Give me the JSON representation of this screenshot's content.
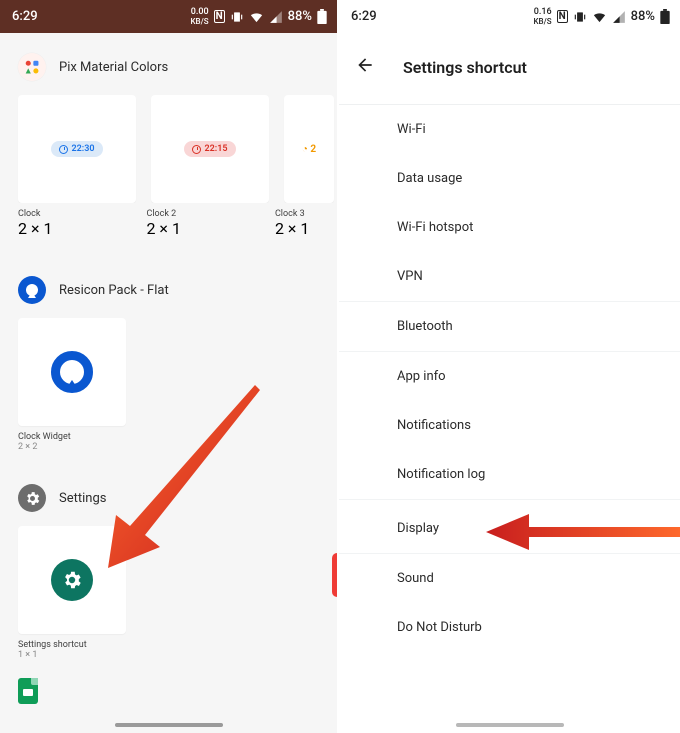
{
  "status_left": {
    "time": "6:29",
    "speed_val": "0.00",
    "speed_unit": "KB/S",
    "battery_pct": "88%"
  },
  "status_right": {
    "time": "6:29",
    "speed_val": "0.16",
    "speed_unit": "KB/S",
    "battery_pct": "88%"
  },
  "left": {
    "section1_title": "Pix Material Colors",
    "clock1": {
      "time": "22:30",
      "label": "Clock",
      "size": "2 × 1"
    },
    "clock2": {
      "time": "22:15",
      "label": "Clock 2",
      "size": "2 × 1"
    },
    "clock3": {
      "label": "Clock 3",
      "size": "2 × 1"
    },
    "section2_title": "Resicon Pack - Flat",
    "resicon_widget": {
      "label": "Clock Widget",
      "size": "2 × 2"
    },
    "section3_title": "Settings",
    "settings_widget": {
      "label": "Settings shortcut",
      "size": "1 × 1"
    }
  },
  "right": {
    "title": "Settings shortcut",
    "items": [
      "Wi-Fi",
      "Data usage",
      "Wi-Fi hotspot",
      "VPN",
      "Bluetooth",
      "App info",
      "Notifications",
      "Notification log",
      "Display",
      "Sound",
      "Do Not Disturb"
    ]
  }
}
